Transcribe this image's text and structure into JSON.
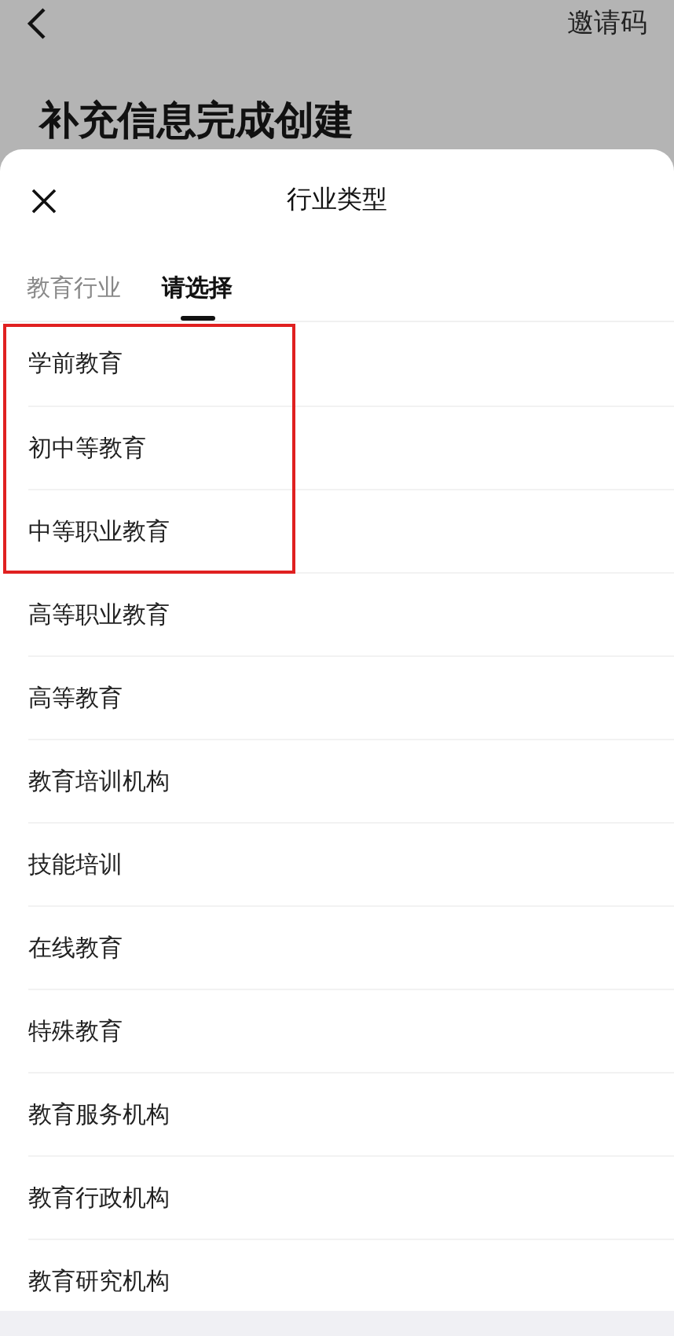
{
  "background": {
    "invite_code": "邀请码",
    "title": "补充信息完成创建"
  },
  "sheet": {
    "title": "行业类型",
    "tabs": [
      {
        "label": "教育行业",
        "selected": false
      },
      {
        "label": "请选择",
        "selected": true
      }
    ],
    "highlighted_items": [
      "学前教育",
      "初中等教育",
      "中等职业教育"
    ],
    "items": [
      "高等职业教育",
      "高等教育",
      "教育培训机构",
      "技能培训",
      "在线教育",
      "特殊教育",
      "教育服务机构",
      "教育行政机构",
      "教育研究机构"
    ]
  }
}
